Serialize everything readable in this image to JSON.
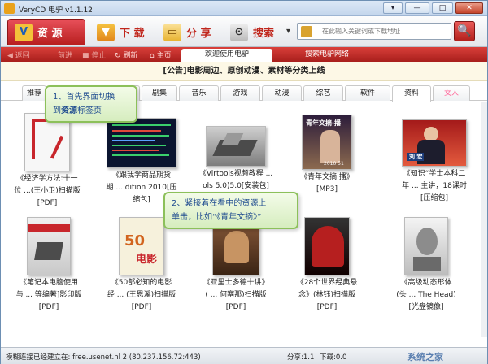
{
  "window": {
    "title": "VeryCD 电驴 v1.1.12",
    "buttons": [
      "▾",
      "—",
      "□",
      "✕"
    ]
  },
  "toolbar": {
    "tabs": [
      {
        "label": "资 源",
        "icon": "resource-v-icon"
      },
      {
        "label": "下 载",
        "icon": "download-icon"
      },
      {
        "label": "分 享",
        "icon": "share-folder-icon"
      },
      {
        "label": "搜索",
        "icon": "search-binoculars-icon"
      }
    ],
    "dropdown": "▾",
    "search_placeholder": "在此输入关键词或下载地址",
    "search_button": "🔍"
  },
  "navbar": {
    "back": "◀ 返回",
    "forward": "前进",
    "stop": "■ 停止",
    "refresh": "↻ 刷新",
    "home": "⌂ 主页",
    "tabs": [
      "欢迎使用电驴",
      "搜索电驴网络"
    ]
  },
  "announcement": "[公告]电影周边、原创动漫、素材等分类上线",
  "content_tabs": [
    "推荐",
    "电影",
    "剧集",
    "音乐",
    "游戏",
    "动漫",
    "综艺",
    "软件",
    "资料",
    "女人"
  ],
  "items": [
    {
      "line1": "《经济学方法:十一",
      "line2": "位 ...(王小卫)扫描版",
      "line3": "[PDF]"
    },
    {
      "line1": "《跟我学商品期货",
      "line2": "期 ... dition 2010[压",
      "line3": "缩包]"
    },
    {
      "line1": "《Virtools视频教程 ...",
      "line2": "ols 5.0)5.0[安装包]",
      "line3": ""
    },
    {
      "line1": "《青年文摘·播》",
      "line2": "[MP3]",
      "line3": "",
      "cover_title": "青年文摘·播",
      "cover_year": "2010 51"
    },
    {
      "line1": "《知识“学士本科二",
      "line2": "年 ... 主讲，18课时",
      "line3": "[压缩包]",
      "cover_name": "刘 宏"
    },
    {
      "line1": "《笔记本电脑使用",
      "line2": "与 ... 等编著]影印版",
      "line3": "[PDF]"
    },
    {
      "line1": "《50部必知的电影",
      "line2": "经 ... (王恩溪)扫描版",
      "line3": "[PDF]",
      "cover_title": "电影",
      "cover_num": "50"
    },
    {
      "line1": "《亚里士多德十讲》",
      "line2": "( ... 何塞那)扫描版",
      "line3": "[PDF]"
    },
    {
      "line1": "《28个世界经典悬",
      "line2": "念》(林钰)扫描版",
      "line3": "[PDF]"
    },
    {
      "line1": "《高级动态形体",
      "line2": "(头 ... The Head)",
      "line3": "[光盘镜像]"
    }
  ],
  "callouts": {
    "c1_line1": "1、首先界面切换",
    "c1_pre": "到",
    "c1_bold": "资源",
    "c1_post": "标签页",
    "c2_line1": "2、紧接着在看中的资源上",
    "c2_line2": "单击，比如“《青年文摘》”"
  },
  "status": {
    "connection": "模糊连接已经建立在: free.usenet.nl 2 (80.237.156.72:443)",
    "share": "分享:1.1",
    "download": "下载:0.0",
    "watermark": "系统之家"
  },
  "colors": {
    "accent": "#c0261c",
    "callout_border": "#8cc05a",
    "callout_text": "#1e4b8f"
  }
}
